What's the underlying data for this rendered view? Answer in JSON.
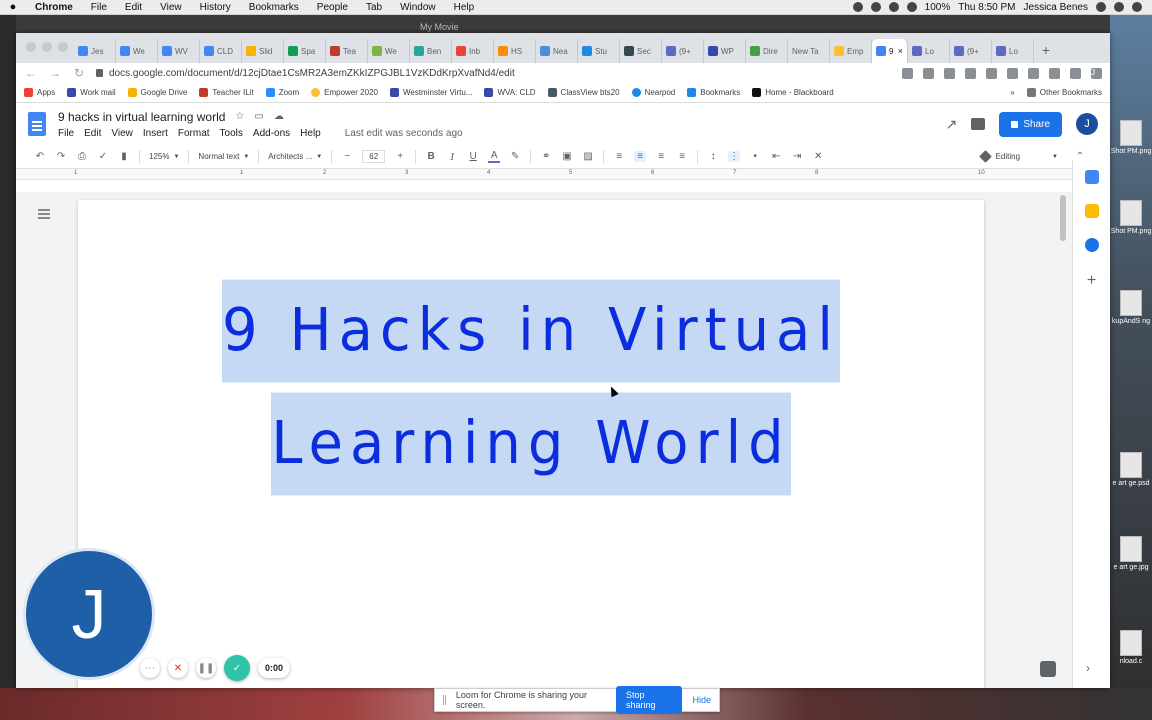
{
  "menubar": {
    "app": "Chrome",
    "items": [
      "File",
      "Edit",
      "View",
      "History",
      "Bookmarks",
      "People",
      "Tab",
      "Window",
      "Help"
    ],
    "battery": "100%",
    "clock": "Thu 8:50 PM",
    "user": "Jessica Benes"
  },
  "window_title": "My Movie",
  "tabs": [
    "Jes",
    "We",
    "WV",
    "CLD",
    "Slid",
    "Spa",
    "Tea",
    "We",
    "Ben",
    "Inb",
    "HS",
    "Nea",
    "Stu",
    "Sec",
    "(9+",
    "WP",
    "Dire",
    "New Ta",
    "Emp",
    "9",
    "Lo",
    "(9+",
    "Lo"
  ],
  "active_tab_index": 19,
  "address_bar": {
    "url": "docs.google.com/document/d/12cjDtae1CsMR2A3emZKkIZPGJBL1VzKDdKrpXvafNd4/edit"
  },
  "bookmarks": [
    "Apps",
    "Work mail",
    "Google Drive",
    "Teacher ILit",
    "Zoom",
    "Empower 2020",
    "Westminster Virtu...",
    "WVA: CLD",
    "ClassView bts20",
    "Nearpod",
    "Bookmarks",
    "Home - Blackboard"
  ],
  "bookmarks_more": "»",
  "bookmarks_other": "Other Bookmarks",
  "doc": {
    "title": "9 hacks in virtual learning world",
    "menus": [
      "File",
      "Edit",
      "View",
      "Insert",
      "Format",
      "Tools",
      "Add-ons",
      "Help"
    ],
    "last_edit": "Last edit was seconds ago",
    "share_label": "Share",
    "avatar_letter": "J"
  },
  "toolbar": {
    "zoom": "125%",
    "style": "Normal text",
    "font": "Architects ...",
    "font_size": "62",
    "mode": "Editing"
  },
  "ruler_numbers": [
    "1",
    "1",
    "2",
    "3",
    "4",
    "5",
    "6",
    "7",
    "8",
    "10"
  ],
  "content": {
    "line1": "9 Hacks in Virtual",
    "line2": "Learning World"
  },
  "loom": {
    "avatar_letter": "J",
    "timer": "0:00",
    "banner_text": "Loom for Chrome is sharing your screen.",
    "stop_label": "Stop sharing",
    "hide_label": "Hide"
  },
  "desktop_files": [
    {
      "label": "Shot PM.png"
    },
    {
      "label": "Shot PM.png"
    },
    {
      "label": "kupAndS ng"
    },
    {
      "label": "e art ge.psd"
    },
    {
      "label": "e art ge.jpg"
    },
    {
      "label": "nload.c"
    }
  ],
  "colors": {
    "docs_blue": "#1a73e8",
    "headline_text": "#0b2dde",
    "selection": "#c6d9f4",
    "loom_avatar": "#1f5fa8"
  }
}
